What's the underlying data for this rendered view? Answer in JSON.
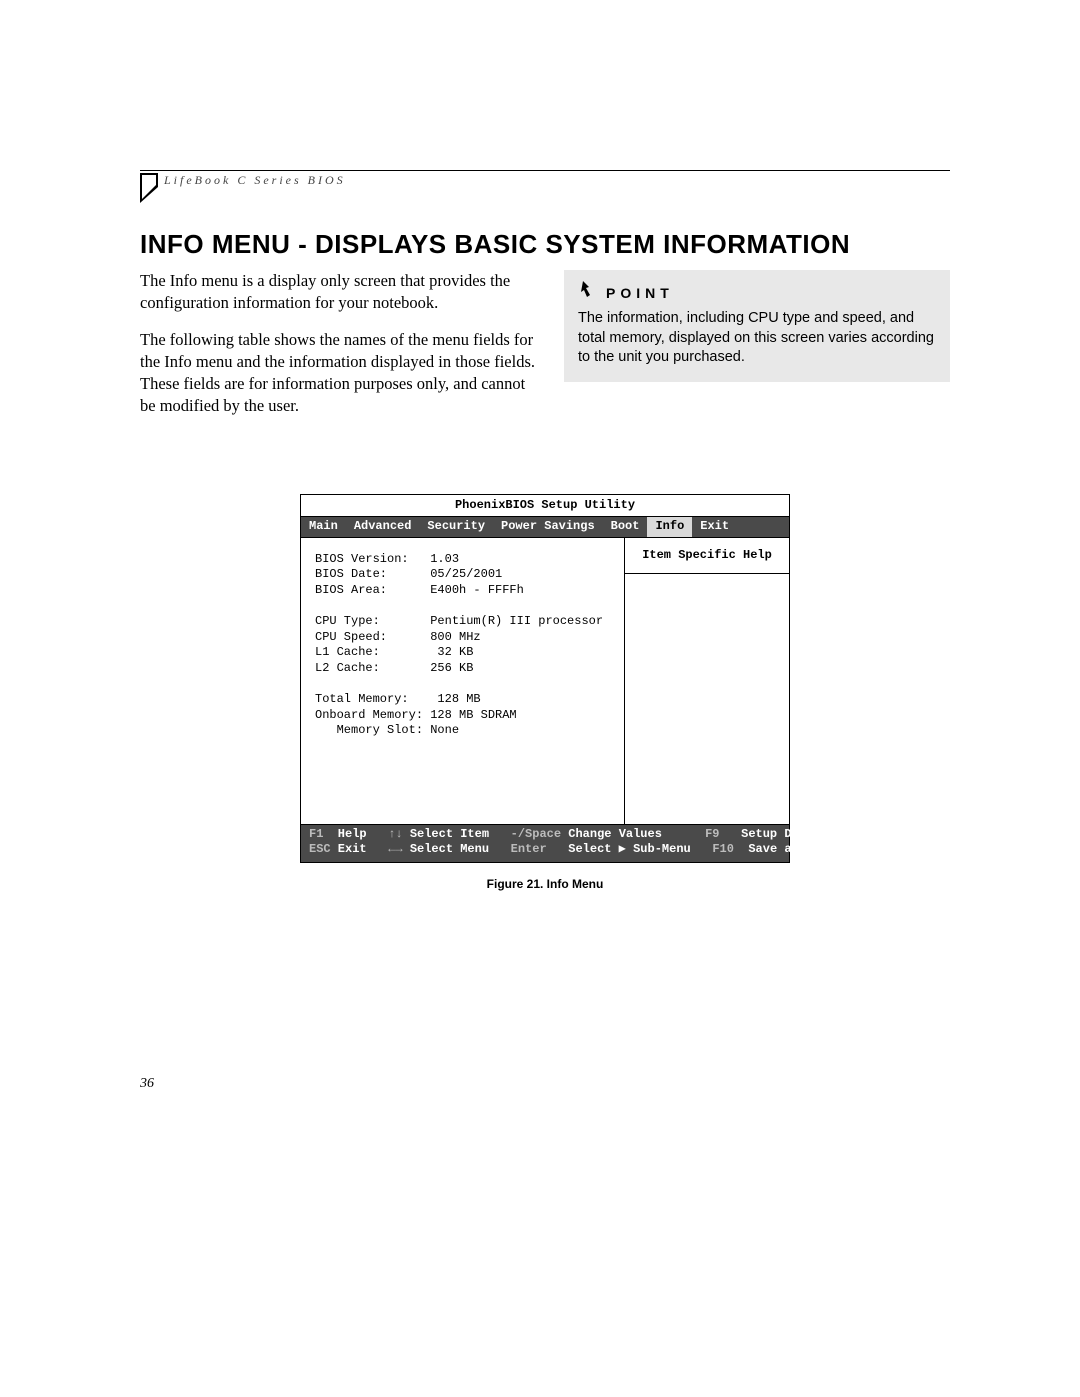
{
  "header": {
    "running_head": "LifeBook C Series BIOS"
  },
  "title": "INFO MENU - DISPLAYS BASIC SYSTEM INFORMATION",
  "body": {
    "para1": "The Info menu is a display only screen that provides the configuration information for your notebook.",
    "para2": "The following table shows the names of the menu fields for the Info menu and the information displayed in those fields. These fields are for information purposes only, and cannot be modified by the user."
  },
  "point": {
    "label": "POINT",
    "text": "The information, including CPU type and speed, and total memory, displayed on this screen varies according to the unit you purchased."
  },
  "bios": {
    "title": "PhoenixBIOS Setup Utility",
    "menu": [
      "Main",
      "Advanced",
      "Security",
      "Power Savings",
      "Boot",
      "Info",
      "Exit"
    ],
    "active_menu": "Info",
    "help_title": "Item Specific Help",
    "fields": [
      {
        "label": "BIOS Version:",
        "value": "1.03"
      },
      {
        "label": "BIOS Date:",
        "value": "05/25/2001"
      },
      {
        "label": "BIOS Area:",
        "value": "E400h - FFFFh"
      },
      {
        "label": "",
        "value": ""
      },
      {
        "label": "CPU Type:",
        "value": "Pentium(R) III processor"
      },
      {
        "label": "CPU Speed:",
        "value": "800 MHz"
      },
      {
        "label": "L1 Cache:",
        "value": " 32 KB"
      },
      {
        "label": "L2 Cache:",
        "value": "256 KB"
      },
      {
        "label": "",
        "value": ""
      },
      {
        "label": "Total Memory:",
        "value": " 128 MB"
      },
      {
        "label": "Onboard Memory:",
        "value": "128 MB SDRAM"
      },
      {
        "label": "   Memory Slot:",
        "value": "None"
      }
    ],
    "footer": {
      "f1": "F1",
      "help": "Help",
      "arrows_v": "↑↓",
      "select_item": "Select Item",
      "minus_space": "-/Space",
      "change_values": "Change Values",
      "f9": "F9",
      "setup_defaults": "Setup Defaults",
      "esc": "ESC",
      "exit": "Exit",
      "arrows_h": "←→",
      "select_menu": "Select Menu",
      "enter": "Enter",
      "select_sub": "Select ▶ Sub-Menu",
      "f10": "F10",
      "save_exit": "Save and Exit"
    }
  },
  "caption": "Figure 21.  Info Menu",
  "page_number": "36"
}
